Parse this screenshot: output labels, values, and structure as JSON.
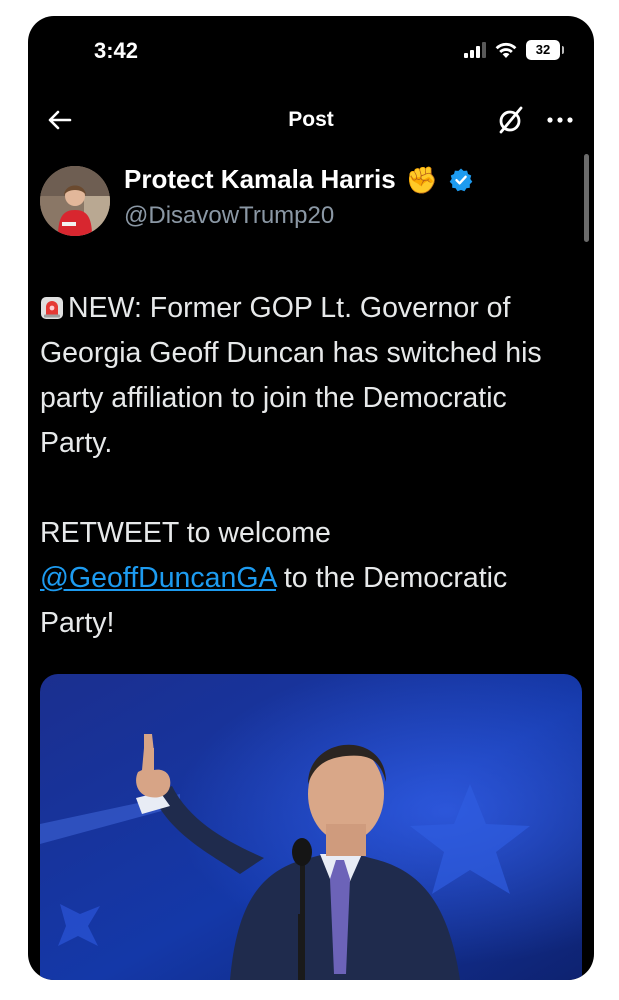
{
  "status_bar": {
    "time": "3:42",
    "battery": "32",
    "icons": [
      "signal-icon",
      "wifi-icon",
      "battery-icon"
    ]
  },
  "nav": {
    "back_icon": "back-arrow-icon",
    "title": "Post",
    "grok_icon": "slashed-circle-icon",
    "more_icon": "more-dots-icon"
  },
  "author": {
    "name": "Protect Kamala Harris",
    "name_emoji": "✊",
    "verified": true,
    "handle": "@DisavowTrump20"
  },
  "post": {
    "siren_icon": "siren-icon",
    "line1": "NEW: Former GOP Lt. Governor of Georgia Geoff Duncan has switched his party affiliation to join the Democratic Party.",
    "line2_before": "RETWEET to welcome ",
    "mention": "@GeoffDuncanGA",
    "line2_after": " to the Democratic Party!"
  },
  "media": {
    "image": "photo of man pointing upward at podium"
  },
  "colors": {
    "background": "#000000",
    "text": "#e7e9ea",
    "secondary": "#8b98a5",
    "link": "#1d9bf0",
    "verified": "#1d9bf0"
  }
}
